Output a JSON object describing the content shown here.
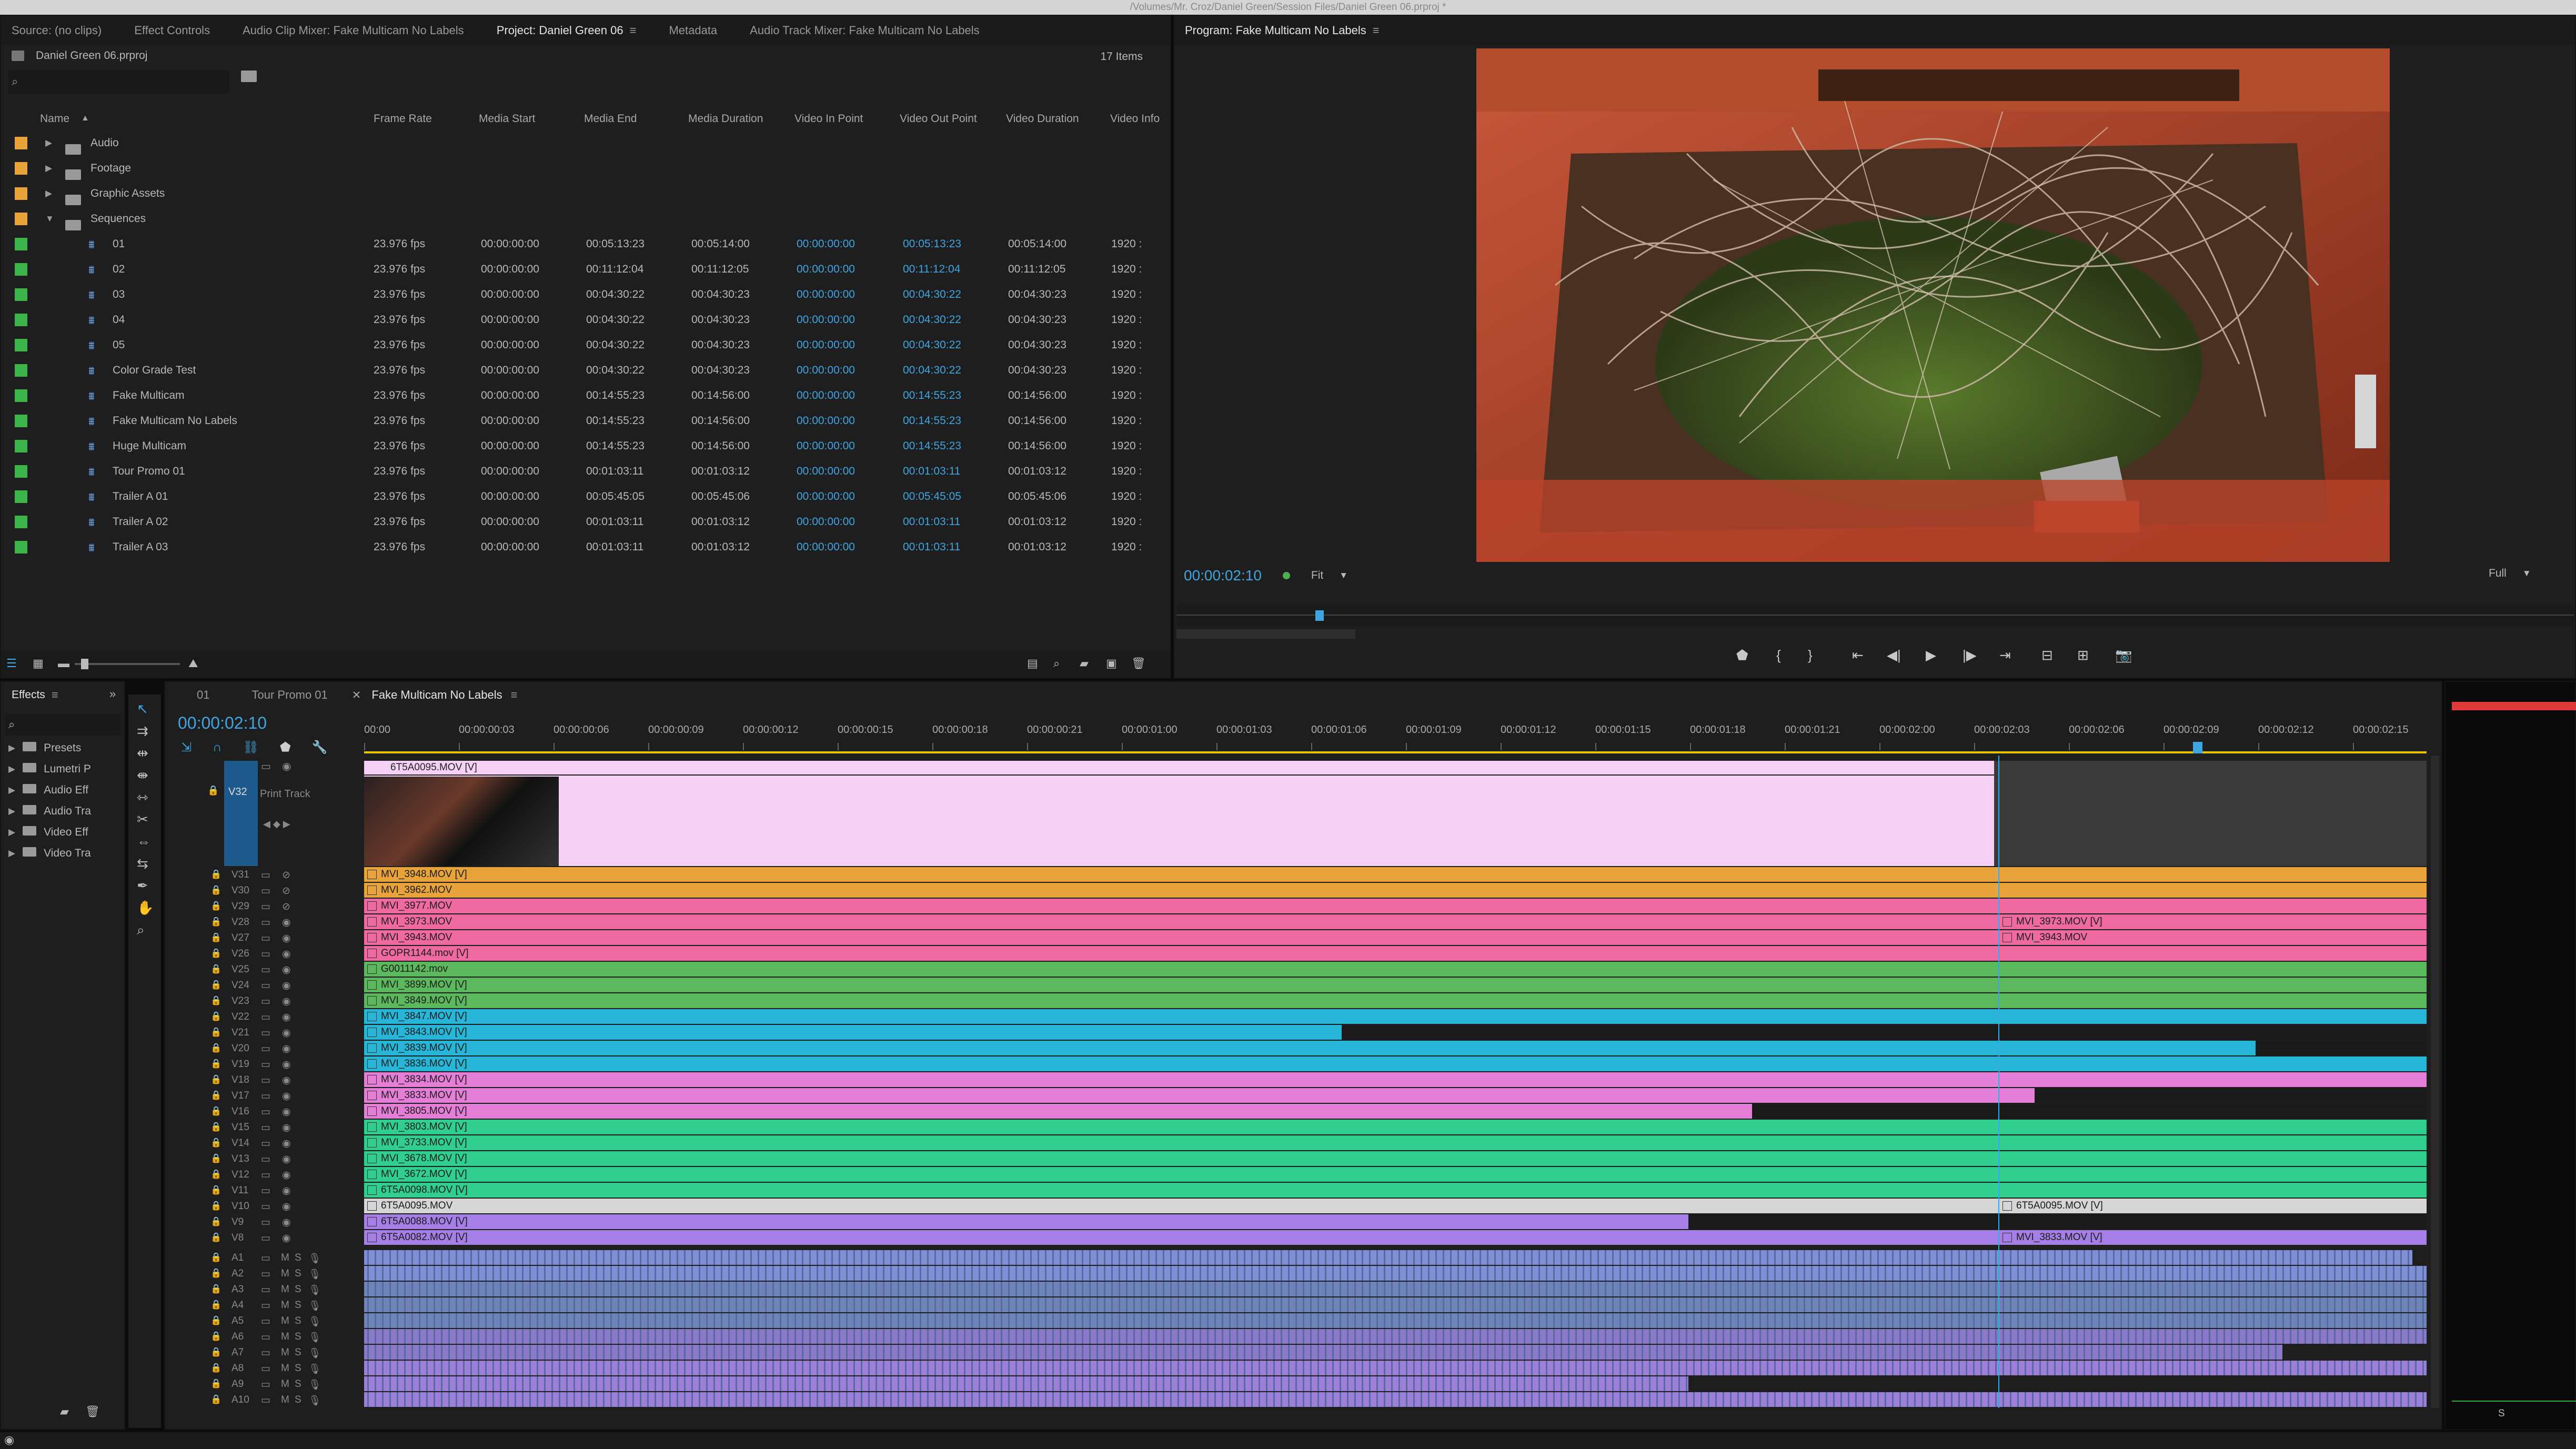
{
  "window": {
    "path": "/Volumes/Mr. Croz/Daniel Green/Session Files/Daniel Green 06.prproj *"
  },
  "top_tabs": [
    "Source: (no clips)",
    "Effect Controls",
    "Audio Clip Mixer: Fake Multicam No Labels",
    "Project: Daniel Green 06",
    "Metadata",
    "Audio Track Mixer: Fake Multicam No Labels"
  ],
  "project": {
    "name": "Daniel Green 06.prproj",
    "items": "17 Items",
    "columns": [
      "Name",
      "Frame Rate",
      "Media Start",
      "Media End",
      "Media Duration",
      "Video In Point",
      "Video Out Point",
      "Video Duration",
      "Video Info"
    ],
    "folders": [
      "Audio",
      "Footage",
      "Graphic Assets",
      "Sequences"
    ],
    "sequences": [
      {
        "name": "01",
        "fps": "23.976 fps",
        "start": "00:00:00:00",
        "end": "00:05:13:23",
        "dur": "00:05:14:00",
        "in": "00:00:00:00",
        "out": "00:05:13:23",
        "vdur": "00:05:14:00",
        "info": "1920 :"
      },
      {
        "name": "02",
        "fps": "23.976 fps",
        "start": "00:00:00:00",
        "end": "00:11:12:04",
        "dur": "00:11:12:05",
        "in": "00:00:00:00",
        "out": "00:11:12:04",
        "vdur": "00:11:12:05",
        "info": "1920 :"
      },
      {
        "name": "03",
        "fps": "23.976 fps",
        "start": "00:00:00:00",
        "end": "00:04:30:22",
        "dur": "00:04:30:23",
        "in": "00:00:00:00",
        "out": "00:04:30:22",
        "vdur": "00:04:30:23",
        "info": "1920 :"
      },
      {
        "name": "04",
        "fps": "23.976 fps",
        "start": "00:00:00:00",
        "end": "00:04:30:22",
        "dur": "00:04:30:23",
        "in": "00:00:00:00",
        "out": "00:04:30:22",
        "vdur": "00:04:30:23",
        "info": "1920 :"
      },
      {
        "name": "05",
        "fps": "23.976 fps",
        "start": "00:00:00:00",
        "end": "00:04:30:22",
        "dur": "00:04:30:23",
        "in": "00:00:00:00",
        "out": "00:04:30:22",
        "vdur": "00:04:30:23",
        "info": "1920 :"
      },
      {
        "name": "Color Grade Test",
        "fps": "23.976 fps",
        "start": "00:00:00:00",
        "end": "00:04:30:22",
        "dur": "00:04:30:23",
        "in": "00:00:00:00",
        "out": "00:04:30:22",
        "vdur": "00:04:30:23",
        "info": "1920 :"
      },
      {
        "name": "Fake Multicam",
        "fps": "23.976 fps",
        "start": "00:00:00:00",
        "end": "00:14:55:23",
        "dur": "00:14:56:00",
        "in": "00:00:00:00",
        "out": "00:14:55:23",
        "vdur": "00:14:56:00",
        "info": "1920 :"
      },
      {
        "name": "Fake Multicam No Labels",
        "fps": "23.976 fps",
        "start": "00:00:00:00",
        "end": "00:14:55:23",
        "dur": "00:14:56:00",
        "in": "00:00:00:00",
        "out": "00:14:55:23",
        "vdur": "00:14:56:00",
        "info": "1920 :"
      },
      {
        "name": "Huge Multicam",
        "fps": "23.976 fps",
        "start": "00:00:00:00",
        "end": "00:14:55:23",
        "dur": "00:14:56:00",
        "in": "00:00:00:00",
        "out": "00:14:55:23",
        "vdur": "00:14:56:00",
        "info": "1920 :"
      },
      {
        "name": "Tour Promo 01",
        "fps": "23.976 fps",
        "start": "00:00:00:00",
        "end": "00:01:03:11",
        "dur": "00:01:03:12",
        "in": "00:00:00:00",
        "out": "00:01:03:11",
        "vdur": "00:01:03:12",
        "info": "1920 :"
      },
      {
        "name": "Trailer A 01",
        "fps": "23.976 fps",
        "start": "00:00:00:00",
        "end": "00:05:45:05",
        "dur": "00:05:45:06",
        "in": "00:00:00:00",
        "out": "00:05:45:05",
        "vdur": "00:05:45:06",
        "info": "1920 :"
      },
      {
        "name": "Trailer A 02",
        "fps": "23.976 fps",
        "start": "00:00:00:00",
        "end": "00:01:03:11",
        "dur": "00:01:03:12",
        "in": "00:00:00:00",
        "out": "00:01:03:11",
        "vdur": "00:01:03:12",
        "info": "1920 :"
      },
      {
        "name": "Trailer A 03",
        "fps": "23.976 fps",
        "start": "00:00:00:00",
        "end": "00:01:03:11",
        "dur": "00:01:03:12",
        "in": "00:00:00:00",
        "out": "00:01:03:11",
        "vdur": "00:01:03:12",
        "info": "1920 :"
      }
    ]
  },
  "program": {
    "title": "Program: Fake Multicam No Labels",
    "timecode": "00:00:02:10",
    "fit": "Fit",
    "quality": "Full"
  },
  "effects": {
    "tab": "Effects",
    "items": [
      "Presets",
      "Lumetri P",
      "Audio Eff",
      "Audio Tra",
      "Video Eff",
      "Video Tra"
    ]
  },
  "timeline": {
    "tabs": [
      "01",
      "Tour Promo 01",
      "Fake Multicam No Labels"
    ],
    "timecode": "00:00:02:10",
    "ruler": [
      "00:00",
      "00:00:00:03",
      "00:00:00:06",
      "00:00:00:09",
      "00:00:00:12",
      "00:00:00:15",
      "00:00:00:18",
      "00:00:00:21",
      "00:00:01:00",
      "00:00:01:03",
      "00:00:01:06",
      "00:00:01:09",
      "00:00:01:12",
      "00:00:01:15",
      "00:00:01:18",
      "00:00:01:21",
      "00:00:02:00",
      "00:00:02:03",
      "00:00:02:06",
      "00:00:02:09",
      "00:00:02:12",
      "00:00:02:15",
      "00"
    ],
    "v32": {
      "label": "V32",
      "name": "Print Track",
      "clip": "6T5A0095.MOV [V]"
    },
    "video_tracks": [
      {
        "t": "V31",
        "clip": "MVI_3948.MOV [V]",
        "color": "#e8a33a",
        "end": 1,
        "tail": ""
      },
      {
        "t": "V30",
        "clip": "MVI_3962.MOV",
        "color": "#e8a33a",
        "end": 1,
        "tail": ""
      },
      {
        "t": "V29",
        "clip": "MVI_3977.MOV",
        "color": "#ef6aa0",
        "end": 1,
        "tail": ""
      },
      {
        "t": "V28",
        "clip": "MVI_3973.MOV",
        "color": "#ef6aa0",
        "end": 1,
        "tail": "MVI_3973.MOV [V]"
      },
      {
        "t": "V27",
        "clip": "MVI_3943.MOV",
        "color": "#ef6aa0",
        "end": 1,
        "tail": "MVI_3943.MOV"
      },
      {
        "t": "V26",
        "clip": "GOPR1144.mov [V]",
        "color": "#ef6aa0",
        "end": 1,
        "tail": ""
      },
      {
        "t": "V25",
        "clip": "G0011142.mov",
        "color": "#5cb85c",
        "end": 1,
        "tail": ""
      },
      {
        "t": "V24",
        "clip": "MVI_3899.MOV [V]",
        "color": "#5cb85c",
        "end": 1,
        "tail": ""
      },
      {
        "t": "V23",
        "clip": "MVI_3849.MOV [V]",
        "color": "#5cb85c",
        "end": 1,
        "tail": ""
      },
      {
        "t": "V22",
        "clip": "MVI_3847.MOV [V]",
        "color": "#27b6d8",
        "end": 1,
        "tail": ""
      },
      {
        "t": "V21",
        "clip": "MVI_3843.MOV [V]",
        "color": "#27b6d8",
        "end": 0.474,
        "tail": ""
      },
      {
        "t": "V20",
        "clip": "MVI_3839.MOV [V]",
        "color": "#27b6d8",
        "end": 0.917,
        "tail": ""
      },
      {
        "t": "V19",
        "clip": "MVI_3836.MOV [V]",
        "color": "#27b6d8",
        "end": 1,
        "tail": ""
      },
      {
        "t": "V18",
        "clip": "MVI_3834.MOV [V]",
        "color": "#e47ed6",
        "end": 1,
        "tail": ""
      },
      {
        "t": "V17",
        "clip": "MVI_3833.MOV [V]",
        "color": "#e47ed6",
        "end": 0.81,
        "tail": ""
      },
      {
        "t": "V16",
        "clip": "MVI_3805.MOV [V]",
        "color": "#e47ed6",
        "end": 0.673,
        "tail": ""
      },
      {
        "t": "V15",
        "clip": "MVI_3803.MOV [V]",
        "color": "#31cf8f",
        "end": 1,
        "tail": ""
      },
      {
        "t": "V14",
        "clip": "MVI_3733.MOV [V]",
        "color": "#31cf8f",
        "end": 1,
        "tail": ""
      },
      {
        "t": "V13",
        "clip": "MVI_3678.MOV [V]",
        "color": "#31cf8f",
        "end": 1,
        "tail": ""
      },
      {
        "t": "V12",
        "clip": "MVI_3672.MOV [V]",
        "color": "#31cf8f",
        "end": 1,
        "tail": ""
      },
      {
        "t": "V11",
        "clip": "6T5A0098.MOV [V]",
        "color": "#31cf8f",
        "end": 1,
        "tail": ""
      },
      {
        "t": "V10",
        "clip": "6T5A0095.MOV",
        "color": "#d6d6d6",
        "end": 0.887,
        "tail": "6T5A0095.MOV [V]"
      },
      {
        "t": "V9",
        "clip": "6T5A0088.MOV [V]",
        "color": "#a57fe6",
        "end": 0.642,
        "tail": ""
      },
      {
        "t": "V8",
        "clip": "6T5A0082.MOV [V]",
        "color": "#a57fe6",
        "end": 0.876,
        "tail": "MVI_3833.MOV [V]"
      }
    ],
    "audio_tracks": [
      {
        "t": "A1",
        "color": "#7f8fd6",
        "end": 0.993
      },
      {
        "t": "A2",
        "color": "#7f8fd6",
        "end": 1
      },
      {
        "t": "A3",
        "color": "#6d84b8",
        "end": 1
      },
      {
        "t": "A4",
        "color": "#6d84b8",
        "end": 1
      },
      {
        "t": "A5",
        "color": "#6d84b8",
        "end": 1
      },
      {
        "t": "A6",
        "color": "#8a78c8",
        "end": 1
      },
      {
        "t": "A7",
        "color": "#8a78c8",
        "end": 0.93
      },
      {
        "t": "A8",
        "color": "#9b7fd8",
        "end": 1
      },
      {
        "t": "A9",
        "color": "#9b7fd8",
        "end": 0.642
      },
      {
        "t": "A10",
        "color": "#9b7fd8",
        "end": 1
      }
    ]
  },
  "meter": {
    "label": "S"
  },
  "colors": {
    "accent": "#3ea6e0",
    "label_orange": "#e8a33a",
    "label_green": "#3bb24a",
    "v32_clip": "#f5d2f5"
  }
}
